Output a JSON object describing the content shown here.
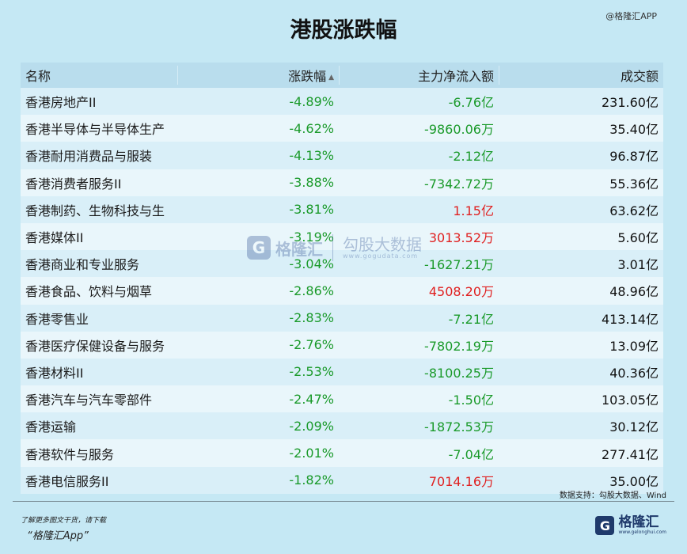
{
  "title": "港股涨跌幅",
  "brand_top": "@格隆汇APP",
  "table": {
    "headers": [
      "名称",
      "涨跌幅",
      "主力净流入额",
      "成交额"
    ],
    "rows": [
      {
        "name": "香港房地产II",
        "change": "-4.89%",
        "flow": "-6.76亿",
        "flow_color": "green",
        "volume": "231.60亿"
      },
      {
        "name": "香港半导体与半导体生产",
        "change": "-4.62%",
        "flow": "-9860.06万",
        "flow_color": "green",
        "volume": "35.40亿"
      },
      {
        "name": "香港耐用消费品与服装",
        "change": "-4.13%",
        "flow": "-2.12亿",
        "flow_color": "green",
        "volume": "96.87亿"
      },
      {
        "name": "香港消费者服务II",
        "change": "-3.88%",
        "flow": "-7342.72万",
        "flow_color": "green",
        "volume": "55.36亿"
      },
      {
        "name": "香港制药、生物科技与生",
        "change": "-3.81%",
        "flow": "1.15亿",
        "flow_color": "red",
        "volume": "63.62亿"
      },
      {
        "name": "香港媒体II",
        "change": "-3.19%",
        "flow": "3013.52万",
        "flow_color": "red",
        "volume": "5.60亿"
      },
      {
        "name": "香港商业和专业服务",
        "change": "-3.04%",
        "flow": "-1627.21万",
        "flow_color": "green",
        "volume": "3.01亿"
      },
      {
        "name": "香港食品、饮料与烟草",
        "change": "-2.86%",
        "flow": "4508.20万",
        "flow_color": "red",
        "volume": "48.96亿"
      },
      {
        "name": "香港零售业",
        "change": "-2.83%",
        "flow": "-7.21亿",
        "flow_color": "green",
        "volume": "413.14亿"
      },
      {
        "name": "香港医疗保健设备与服务",
        "change": "-2.76%",
        "flow": "-7802.19万",
        "flow_color": "green",
        "volume": "13.09亿"
      },
      {
        "name": "香港材料II",
        "change": "-2.53%",
        "flow": "-8100.25万",
        "flow_color": "green",
        "volume": "40.36亿"
      },
      {
        "name": "香港汽车与汽车零部件",
        "change": "-2.47%",
        "flow": "-1.50亿",
        "flow_color": "green",
        "volume": "103.05亿"
      },
      {
        "name": "香港运输",
        "change": "-2.09%",
        "flow": "-1872.53万",
        "flow_color": "green",
        "volume": "30.12亿"
      },
      {
        "name": "香港软件与服务",
        "change": "-2.01%",
        "flow": "-7.04亿",
        "flow_color": "green",
        "volume": "277.41亿"
      },
      {
        "name": "香港电信服务II",
        "change": "-1.82%",
        "flow": "7014.16万",
        "flow_color": "red",
        "volume": "35.00亿"
      }
    ]
  },
  "source": "数据支持：勾股大数据、Wind",
  "footer": {
    "note": "了解更多图文干货，请下载",
    "app": "“格隆汇App”",
    "logo_mark": "G",
    "logo_text": "格隆汇",
    "logo_sub": "www.gelonghui.com"
  },
  "watermark": {
    "mark": "G",
    "text1": "格隆汇",
    "text2": "勾股大数据",
    "url": "www.gogudata.com"
  },
  "colors": {
    "green": "#1a9a2a",
    "red": "#e02020",
    "background": "#c5e8f4"
  }
}
